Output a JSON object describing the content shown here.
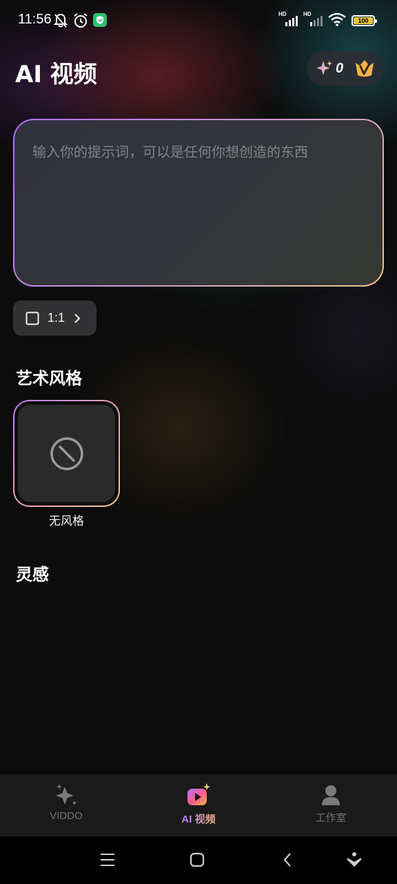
{
  "status_bar": {
    "time": "11:56",
    "signal1_label": "HD",
    "signal2_label": "HD",
    "battery": "100",
    "icons": [
      "bell-off-icon",
      "alarm-icon",
      "shield-app-icon",
      "signal-icon",
      "signal-icon",
      "wifi-icon",
      "battery-icon"
    ]
  },
  "header": {
    "title": "AI 视频",
    "credits": "0",
    "icons": [
      "sparkle-credit-icon",
      "vip-crown-icon"
    ]
  },
  "prompt": {
    "placeholder": "输入你的提示词，可以是任何你想创造的东西",
    "value": ""
  },
  "aspect": {
    "label": "1:1",
    "icons": [
      "square-icon",
      "chevron-right-icon"
    ]
  },
  "art_style": {
    "title": "艺术风格",
    "items": [
      {
        "label": "无风格",
        "icon": "no-style-icon",
        "selected": true
      }
    ]
  },
  "inspiration": {
    "title": "灵感"
  },
  "bottom_nav": {
    "tabs": [
      {
        "label": "VIDDO",
        "icon": "sparkle-icon",
        "active": false
      },
      {
        "label": "AI 视频",
        "icon": "ai-video-icon",
        "active": true
      },
      {
        "label": "工作室",
        "icon": "user-icon",
        "active": false
      }
    ]
  },
  "system_nav": {
    "icons": [
      "menu-icon",
      "home-icon",
      "back-icon",
      "assistant-icon"
    ]
  },
  "colors": {
    "accent_gradient": [
      "#b06dff",
      "#f0c48a"
    ],
    "battery": "#e8c640",
    "vip": "#f2b54a"
  }
}
